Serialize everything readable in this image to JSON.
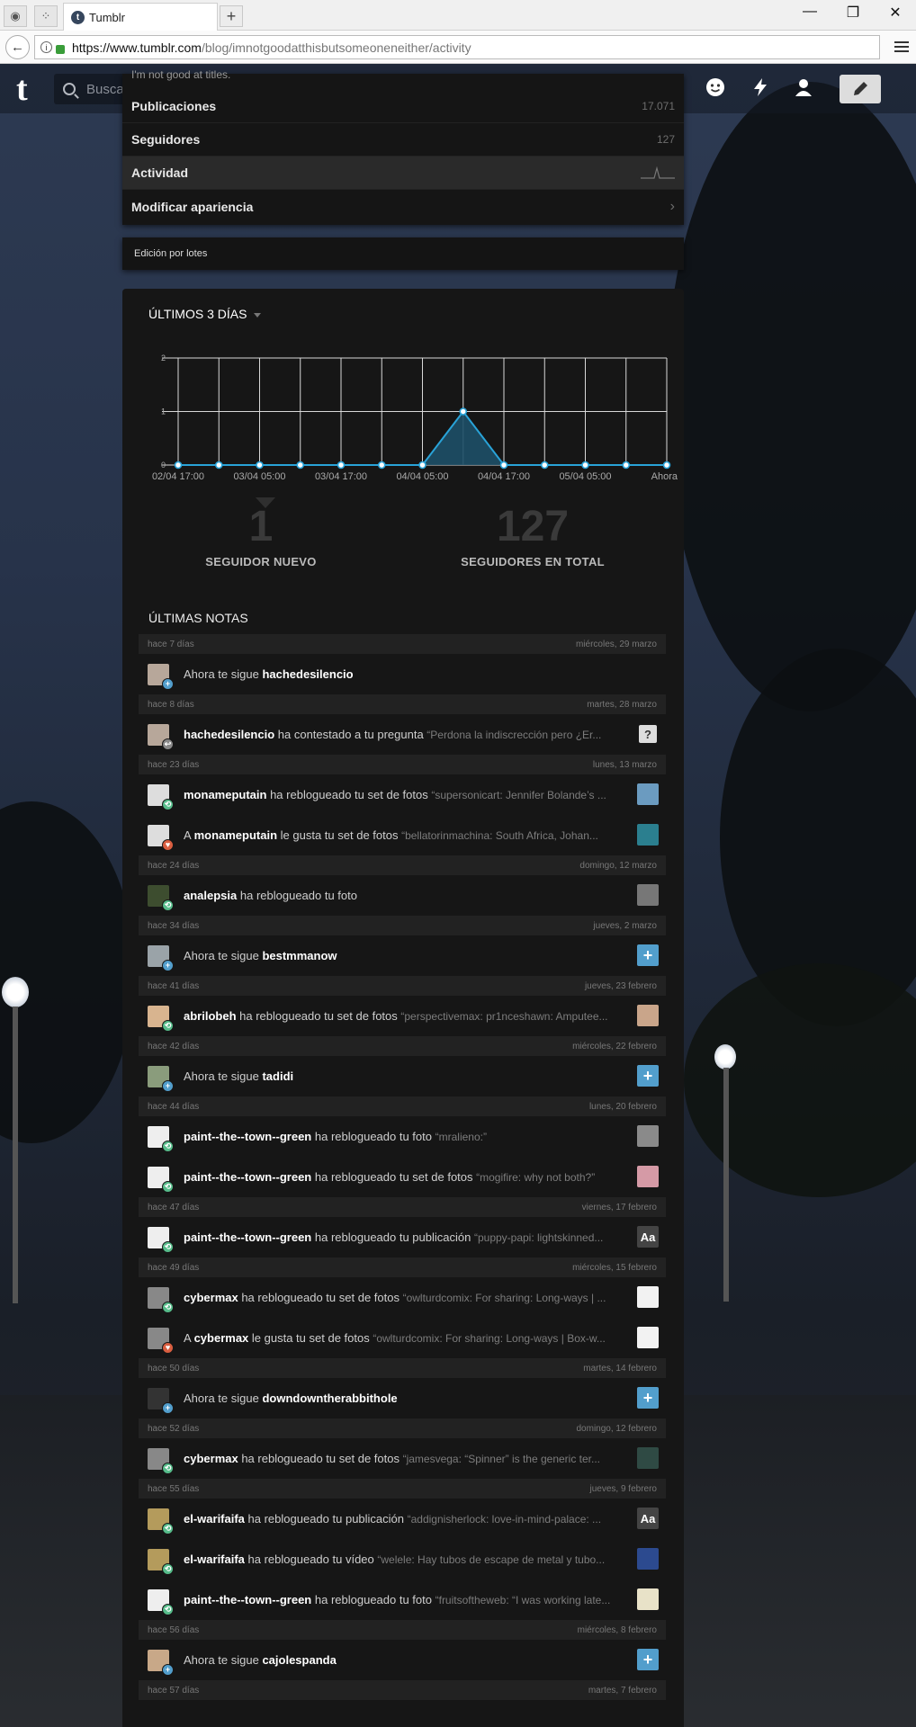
{
  "browser": {
    "tab_title": "Tumblr",
    "tab_favicon": "t",
    "new_tab": "+",
    "url_domain": "https://www.tumblr.com",
    "url_path": "/blog/imnotgoodatthisbutsomeoneneither/activity",
    "min_icon": "—",
    "restore_icon": "❐",
    "close_icon": "✕"
  },
  "header": {
    "logo": "t",
    "search_placeholder": "Buscar en Tumblr",
    "icons": [
      "home-icon",
      "compass-icon",
      "mail-icon",
      "smiley-icon",
      "lightning-icon",
      "account-icon",
      "pencil-icon"
    ]
  },
  "blog_menu": {
    "tagline": "I'm not good at titles.",
    "items": [
      {
        "label": "Publicaciones",
        "value": "17.071"
      },
      {
        "label": "Seguidores",
        "value": "127"
      },
      {
        "label": "Actividad",
        "value": ""
      },
      {
        "label": "Modificar apariencia",
        "value": "›"
      }
    ],
    "batch_edit": "Edición por lotes"
  },
  "activity": {
    "range_label": "ÚLTIMOS 3 DÍAS",
    "chart_data": {
      "type": "area",
      "x": [
        "02/04 17:00",
        "",
        "03/04 05:00",
        "",
        "03/04 17:00",
        "",
        "04/04 05:00",
        "",
        "04/04 17:00",
        "",
        "05/04 05:00",
        "",
        "Ahora"
      ],
      "tick_labels": [
        "02/04 17:00",
        "03/04 05:00",
        "03/04 17:00",
        "04/04 05:00",
        "04/04 17:00",
        "05/04 05:00",
        "Ahora"
      ],
      "values": [
        0,
        0,
        0,
        0,
        0,
        0,
        0,
        1,
        0,
        0,
        0,
        0,
        0
      ],
      "y_ticks": [
        "0",
        "1",
        "2"
      ],
      "ylim": [
        0,
        2
      ],
      "grid": true,
      "line_color": "#29a3d8",
      "fill_color": "#1d4f67"
    },
    "new_followers": {
      "value": "1",
      "label": "SEGUIDOR NUEVO"
    },
    "total_followers": {
      "value": "127",
      "label": "SEGUIDORES EN TOTAL"
    },
    "notes_title": "ÚLTIMAS NOTAS"
  },
  "notes": [
    {
      "ago": "hace 7 días",
      "date": "miércoles, 29 marzo",
      "items": [
        {
          "pre": "Ahora te sigue ",
          "user": "hachedesilencio",
          "action": "",
          "quote": "",
          "badge": "follow",
          "right": "none",
          "av": "#b7a79a"
        }
      ]
    },
    {
      "ago": "hace 8 días",
      "date": "martes, 28 marzo",
      "items": [
        {
          "pre": "",
          "user": "hachedesilencio",
          "action": " ha contestado a tu pregunta ",
          "quote": "“Perdona la indiscrección pero ¿Er...",
          "badge": "answer",
          "right": "question",
          "av": "#b7a79a"
        }
      ]
    },
    {
      "ago": "hace 23 días",
      "date": "lunes, 13 marzo",
      "items": [
        {
          "pre": "",
          "user": "monameputain",
          "action": " ha reblogueado tu set de fotos ",
          "quote": "“supersonicart: Jennifer Bolande’s ...",
          "badge": "reblog",
          "right": "thumb",
          "thumb": "#6b9bc0",
          "av": "#ddd"
        },
        {
          "pre": "A ",
          "user": "monameputain",
          "action": " le gusta tu set de fotos ",
          "quote": "“bellatorinmachina: South Africa, Johan...",
          "badge": "like",
          "right": "thumb",
          "thumb": "#2b7f8f",
          "av": "#ddd"
        }
      ]
    },
    {
      "ago": "hace 24 días",
      "date": "domingo, 12 marzo",
      "items": [
        {
          "pre": "",
          "user": "analepsia",
          "action": " ha reblogueado tu foto",
          "quote": "",
          "badge": "reblog",
          "right": "thumb",
          "thumb": "#777",
          "av": "#3d4d2f"
        }
      ]
    },
    {
      "ago": "hace 34 días",
      "date": "jueves, 2 marzo",
      "items": [
        {
          "pre": "Ahora te sigue ",
          "user": "bestmmanow",
          "action": "",
          "quote": "",
          "badge": "follow",
          "right": "plus",
          "av": "#9aa3a8"
        }
      ]
    },
    {
      "ago": "hace 41 días",
      "date": "jueves, 23 febrero",
      "items": [
        {
          "pre": "",
          "user": "abrilobeh",
          "action": " ha reblogueado tu set de fotos ",
          "quote": "“perspectivemax: pr1nceshawn: Amputee...",
          "badge": "reblog",
          "right": "thumb",
          "thumb": "#c9a58a",
          "av": "#d8b48f"
        }
      ]
    },
    {
      "ago": "hace 42 días",
      "date": "miércoles, 22 febrero",
      "items": [
        {
          "pre": "Ahora te sigue ",
          "user": "tadidi",
          "action": "",
          "quote": "",
          "badge": "follow",
          "right": "plus",
          "av": "#8a9c7c"
        }
      ]
    },
    {
      "ago": "hace 44 días",
      "date": "lunes, 20 febrero",
      "items": [
        {
          "pre": "",
          "user": "paint--the--town--green",
          "action": " ha reblogueado tu foto ",
          "quote": "“mralieno:”",
          "badge": "reblog",
          "right": "thumb",
          "thumb": "#8a8a8a",
          "av": "#eee"
        },
        {
          "pre": "",
          "user": "paint--the--town--green",
          "action": " ha reblogueado tu set de fotos ",
          "quote": "“mogifire: why not both?”",
          "badge": "reblog",
          "right": "thumb",
          "thumb": "#d59aa6",
          "av": "#eee"
        }
      ]
    },
    {
      "ago": "hace 47 días",
      "date": "viernes, 17 febrero",
      "items": [
        {
          "pre": "",
          "user": "paint--the--town--green",
          "action": " ha reblogueado tu publicación ",
          "quote": "“puppy-papi: lightskinned...",
          "badge": "reblog",
          "right": "text",
          "av": "#eee"
        }
      ]
    },
    {
      "ago": "hace 49 días",
      "date": "miércoles, 15 febrero",
      "items": [
        {
          "pre": "",
          "user": "cybermax",
          "action": " ha reblogueado tu set de fotos ",
          "quote": "“owlturdcomix: For sharing: Long-ways | ...",
          "badge": "reblog",
          "right": "thumb",
          "thumb": "#f2f2f2",
          "av": "#888"
        },
        {
          "pre": "A ",
          "user": "cybermax",
          "action": " le gusta tu set de fotos ",
          "quote": "“owlturdcomix: For sharing: Long-ways | Box-w...",
          "badge": "like",
          "right": "thumb",
          "thumb": "#f2f2f2",
          "av": "#888"
        }
      ]
    },
    {
      "ago": "hace 50 días",
      "date": "martes, 14 febrero",
      "items": [
        {
          "pre": "Ahora te sigue ",
          "user": "downdowntherabbithole",
          "action": "",
          "quote": "",
          "badge": "follow",
          "right": "plus",
          "av": "#333"
        }
      ]
    },
    {
      "ago": "hace 52 días",
      "date": "domingo, 12 febrero",
      "items": [
        {
          "pre": "",
          "user": "cybermax",
          "action": " ha reblogueado tu set de fotos ",
          "quote": "“jamesvega: “Spinner” is the generic ter...",
          "badge": "reblog",
          "right": "thumb",
          "thumb": "#2f4a44",
          "av": "#888"
        }
      ]
    },
    {
      "ago": "hace 55 días",
      "date": "jueves, 9 febrero",
      "items": [
        {
          "pre": "",
          "user": "el-warifaifa",
          "action": " ha reblogueado tu publicación ",
          "quote": "“addignisherlock: love-in-mind-palace: ...",
          "badge": "reblog",
          "right": "text",
          "av": "#b49b5c"
        },
        {
          "pre": "",
          "user": "el-warifaifa",
          "action": " ha reblogueado tu vídeo ",
          "quote": "“welele: Hay tubos de escape de metal y tubo...",
          "badge": "reblog",
          "right": "thumb",
          "thumb": "#2c4a8f",
          "av": "#b49b5c"
        },
        {
          "pre": "",
          "user": "paint--the--town--green",
          "action": " ha reblogueado tu foto ",
          "quote": "“fruitsoftheweb: “I was working late...",
          "badge": "reblog",
          "right": "thumb",
          "thumb": "#e8e2c8",
          "av": "#eee"
        }
      ]
    },
    {
      "ago": "hace 56 días",
      "date": "miércoles, 8 febrero",
      "items": [
        {
          "pre": "Ahora te sigue ",
          "user": "cajolespanda",
          "action": "",
          "quote": "",
          "badge": "follow",
          "right": "plus",
          "av": "#c8a888"
        }
      ]
    },
    {
      "ago": "hace 57 días",
      "date": "martes, 7 febrero",
      "items": []
    }
  ],
  "text_icon_label": "Aa",
  "question_icon_label": "?",
  "plus_icon_label": "+"
}
